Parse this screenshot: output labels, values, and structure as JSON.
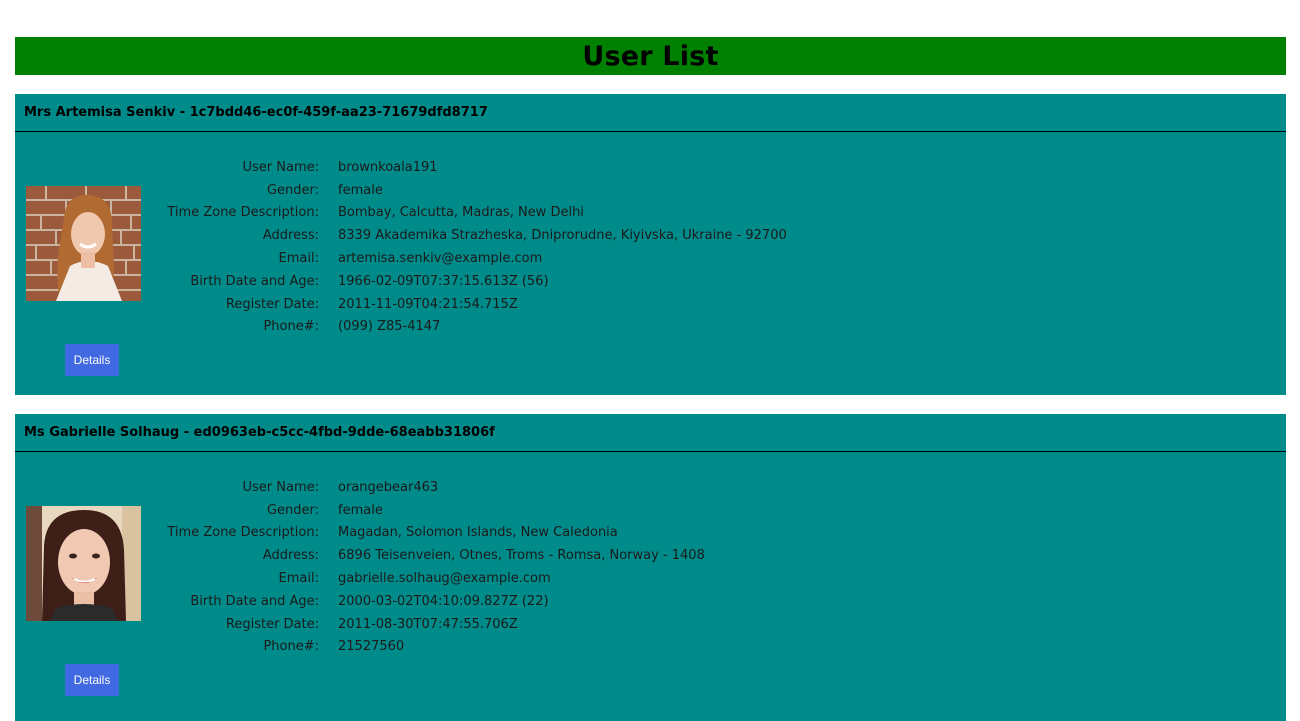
{
  "page": {
    "title": "User List"
  },
  "labels": {
    "user_name": "User Name:",
    "gender": "Gender:",
    "time_zone": "Time Zone Description:",
    "address": "Address:",
    "email": "Email:",
    "birth": "Birth Date and Age:",
    "register": "Register Date:",
    "phone": "Phone#:",
    "details_button": "Details"
  },
  "colors": {
    "header_bg": "#008000",
    "card_bg": "#008b8b",
    "button_bg": "#4169e1"
  },
  "users": [
    {
      "heading": "Mrs Artemisa Senkiv - 1c7bdd46-ec0f-459f-aa23-71679dfd8717",
      "user_name": "brownkoala191",
      "gender": "female",
      "time_zone": "Bombay, Calcutta, Madras, New Delhi",
      "address": "8339 Akademika Strazheska, Dniprorudne, Kiyivska, Ukraine - 92700",
      "email": "artemisa.senkiv@example.com",
      "birth": "1966-02-09T07:37:15.613Z (56)",
      "register": "2011-11-09T04:21:54.715Z",
      "phone": "(099) Z85-4147"
    },
    {
      "heading": "Ms Gabrielle Solhaug - ed0963eb-c5cc-4fbd-9dde-68eabb31806f",
      "user_name": "orangebear463",
      "gender": "female",
      "time_zone": "Magadan, Solomon Islands, New Caledonia",
      "address": "6896 Teisenveien, Otnes, Troms - Romsa, Norway - 1408",
      "email": "gabrielle.solhaug@example.com",
      "birth": "2000-03-02T04:10:09.827Z (22)",
      "register": "2011-08-30T07:47:55.706Z",
      "phone": "21527560"
    }
  ]
}
